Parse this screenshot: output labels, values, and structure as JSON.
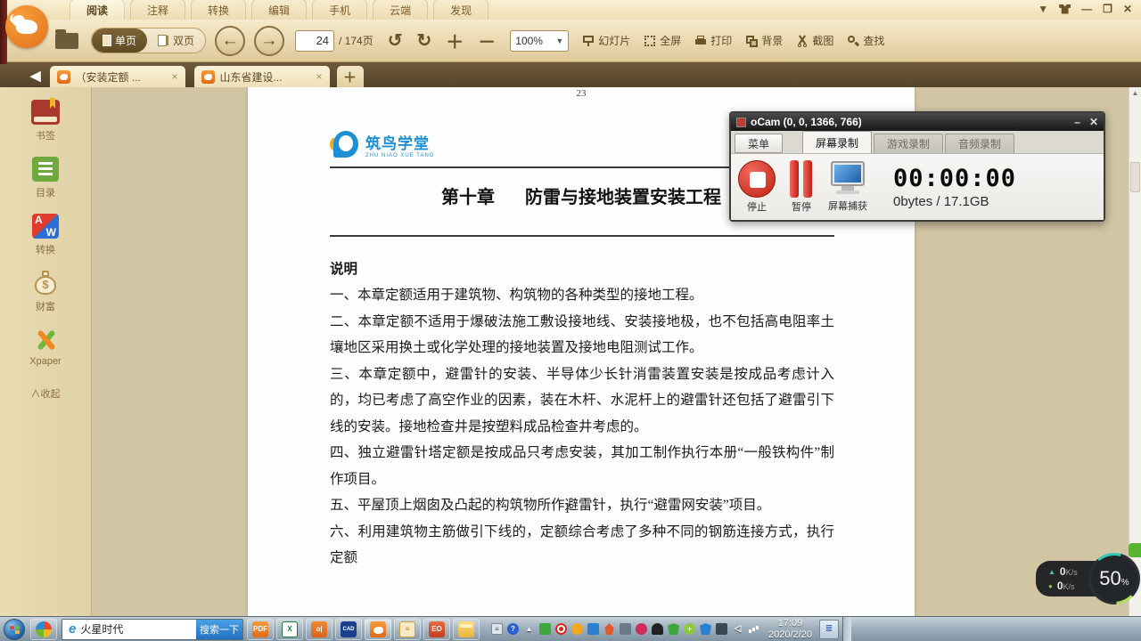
{
  "menu": {
    "items": [
      {
        "label": "阅读"
      },
      {
        "label": "注释"
      },
      {
        "label": "转换"
      },
      {
        "label": "编辑"
      },
      {
        "label": "手机"
      },
      {
        "label": "云端"
      },
      {
        "label": "发现"
      }
    ]
  },
  "window_controls": {
    "dropdown": "▼",
    "minimize": "—",
    "restore": "❐",
    "close": "✕"
  },
  "toolbar": {
    "single_page": "单页",
    "double_page": "双页",
    "prev": "←",
    "next": "→",
    "page_current": "24",
    "page_total_suffix": "/ 174页",
    "undo": "↺",
    "redo": "↻",
    "zoom_in": "＋",
    "zoom_out": "－",
    "zoom_value": "100%",
    "zoom_caret": "▼",
    "slideshow": "幻灯片",
    "fullscreen": "全屏",
    "print": "打印",
    "background": "背景",
    "screenshot": "截图",
    "find": "查找"
  },
  "tabbar": {
    "collapse": "◀",
    "tab1": {
      "label": "（安装定额 ...",
      "close": "×"
    },
    "tab2": {
      "label": "山东省建设...",
      "close": "×"
    },
    "new_tab": "＋"
  },
  "sidebar": {
    "items": [
      {
        "label": "书签"
      },
      {
        "label": "目录"
      },
      {
        "label": "转换"
      },
      {
        "label": "财富"
      },
      {
        "label": "Xpaper"
      }
    ],
    "collapse_label": "∧收起"
  },
  "document": {
    "prev_page_number": "23",
    "brand": "筑鸟学堂",
    "brand_caption": "ZHU NIAO XUE TANG",
    "chapter_no": "第十章",
    "chapter_name": "防雷与接地装置安装工程",
    "section_heading": "说明",
    "paragraphs": [
      "一、本章定额适用于建筑物、构筑物的各种类型的接地工程。",
      "二、本章定额不适用于爆破法施工敷设接地线、安装接地极，也不包括高电阻率土壤地区采用换土或化学处理的接地装置及接地电阻测试工作。",
      "三、本章定额中，避雷针的安装、半导体少长针消雷装置安装是按成品考虑计入的，均已考虑了高空作业的因素，装在木杆、水泥杆上的避雷针还包括了避雷引下线的安装。接地检查井是按塑料成品检查井考虑的。",
      "四、独立避雷针塔定额是按成品只考虑安装，其加工制作执行本册“一般铁构件”制作项目。",
      "五、平屋顶上烟囱及凸起的构筑物所作避雷针，执行“避雷网安装”项目。",
      "六、利用建筑物主筋做引下线的，定额综合考虑了多种不同的钢筋连接方式，执行定额"
    ]
  },
  "ocam": {
    "title": "oCam (0, 0, 1366, 766)",
    "minimize": "–",
    "close": "✕",
    "menu_button": "菜单",
    "tabs": [
      {
        "label": "屏幕录制"
      },
      {
        "label": "游戏录制"
      },
      {
        "label": "音频录制"
      }
    ],
    "stop_label": "停止",
    "pause_label": "暂停",
    "capture_label": "屏幕捕获",
    "timer": "00:00:00",
    "size_info": "0bytes / 17.1GB"
  },
  "net_overlay": {
    "up_icon": "▲",
    "down_icon": "●",
    "up_value": "0",
    "up_unit": "K/s",
    "down_value": "0",
    "down_unit": "K/s",
    "percent": "50",
    "percent_sign": "%"
  },
  "taskbar": {
    "search_engine_text": "火星时代",
    "search_button": "搜索一下",
    "ie_glyph": "e",
    "clock_time": "17:09",
    "clock_date": "2020/2/20",
    "tray_hidden_arrow": "▲",
    "help_glyph": "?",
    "volume_glyph": "◁",
    "app_glyphs": {
      "pdf": "PDF",
      "excel": "X",
      "orange01": "o|",
      "cad": "CAD",
      "note": "≡",
      "ppt": "EO"
    }
  },
  "colors": {
    "accent_orange": "#e8761c",
    "toolbar_tan": "#e6d2a6",
    "tabbar_brown": "#5f4e33",
    "page_white": "#fefefe",
    "ocam_red": "#c01f10",
    "taskbar_blue": "#9fb0bd",
    "brand_blue": "#1e8fd5"
  },
  "icons_legend": [
    "folder-open-icon",
    "single-page-icon",
    "double-page-icon",
    "prev-page-icon",
    "next-page-icon",
    "undo-icon",
    "redo-icon",
    "zoom-in-icon",
    "zoom-out-icon",
    "slideshow-icon",
    "fullscreen-icon",
    "print-icon",
    "background-icon",
    "scissors-icon",
    "search-icon",
    "bookmark-icon",
    "toc-icon",
    "convert-icon",
    "wealth-icon",
    "xpaper-icon",
    "stop-icon",
    "pause-icon",
    "screen-capture-icon",
    "windows-start-icon",
    "ie-icon",
    "tray-icons",
    "text-cursor"
  ]
}
